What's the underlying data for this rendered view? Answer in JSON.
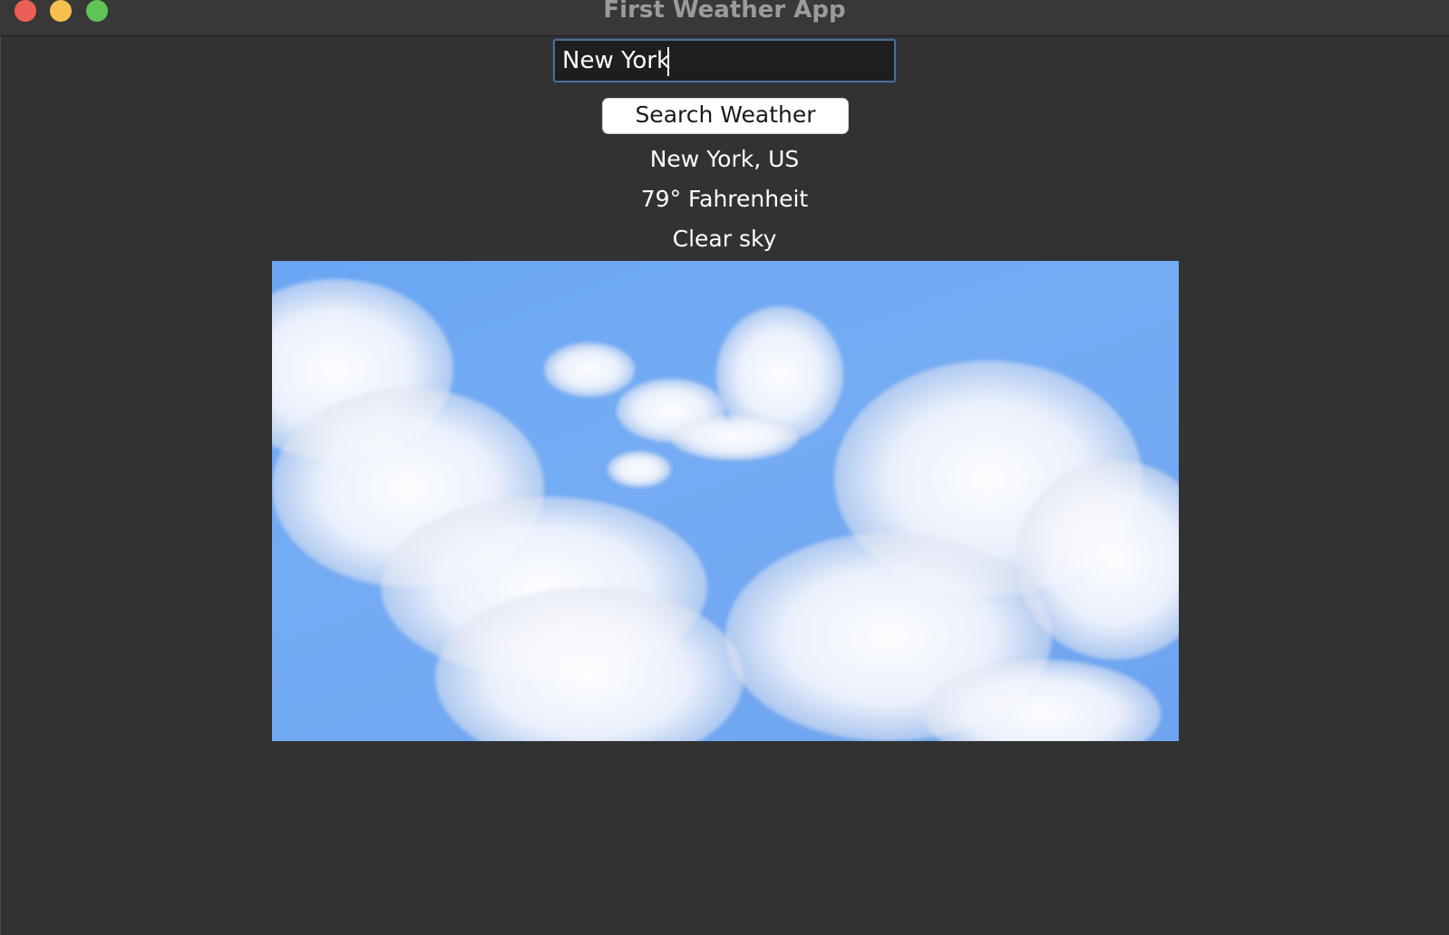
{
  "window": {
    "title": "First Weather App"
  },
  "search": {
    "value": "New York",
    "button_label": "Search Weather"
  },
  "weather": {
    "location": "New York, US",
    "temperature": "79° Fahrenheit",
    "description": "Clear sky"
  },
  "image": {
    "subject": "blue sky with white clouds"
  },
  "colors": {
    "close": "#ec5f57",
    "minimize": "#f5bf4f",
    "zoom": "#5fc454",
    "window_bg": "#323232",
    "input_focus_border": "#4c6d93"
  }
}
